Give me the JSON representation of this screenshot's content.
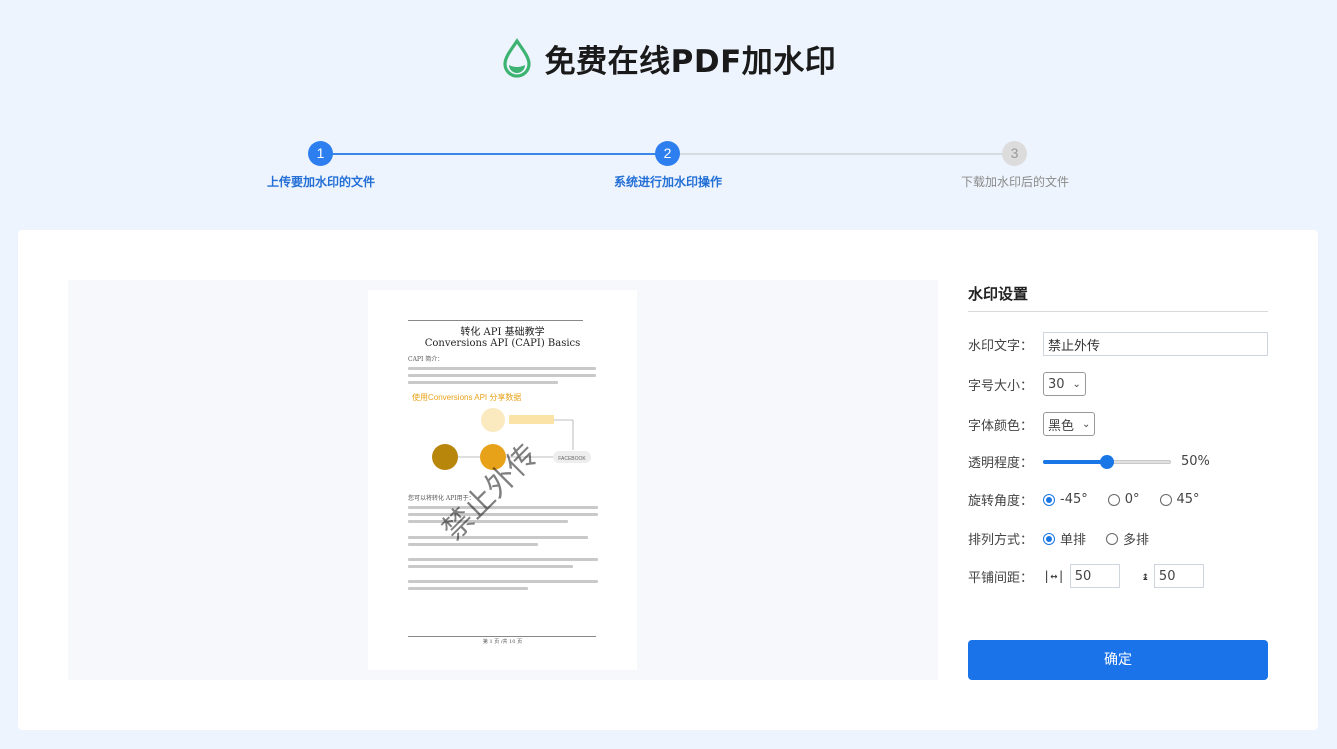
{
  "header": {
    "title": "免费在线PDF加水印",
    "icon": "water-drop-icon",
    "accent": "#3cb371"
  },
  "steps": [
    {
      "num": "1",
      "label": "上传要加水印的文件",
      "state": "active"
    },
    {
      "num": "2",
      "label": "系统进行加水印操作",
      "state": "active"
    },
    {
      "num": "3",
      "label": "下载加水印后的文件",
      "state": "inactive"
    }
  ],
  "preview": {
    "doc_title_1": "转化 API 基础教学",
    "doc_title_2": "Conversions API (CAPI) Basics",
    "section_heading": "CAPI 简介：",
    "figure_heading": "使用Conversions API 分享数据",
    "figure_label": "FACEBOOK",
    "section_2": "您可以将转化 API用于：",
    "footer": "第 1 页 /共 10 页",
    "watermark": "禁止外传"
  },
  "settings": {
    "heading": "水印设置",
    "text_label": "水印文字：",
    "text_value": "禁止外传",
    "size_label": "字号大小：",
    "size_value": "30",
    "color_label": "字体颜色：",
    "color_value": "黑色",
    "opacity_label": "透明程度：",
    "opacity_value": 50,
    "opacity_text": "50%",
    "rotation_label": "旋转角度：",
    "rotation_options": [
      "-45°",
      "0°",
      "45°"
    ],
    "rotation_selected": 0,
    "layout_label": "排列方式：",
    "layout_options": [
      "单排",
      "多排"
    ],
    "layout_selected": 0,
    "spacing_label": "平铺间距：",
    "spacing_h": "50",
    "spacing_v": "50",
    "confirm": "确定"
  },
  "colors": {
    "primary": "#1a73e8",
    "step_active": "#2d7ff0",
    "step_inactive": "#dcdcdc"
  }
}
